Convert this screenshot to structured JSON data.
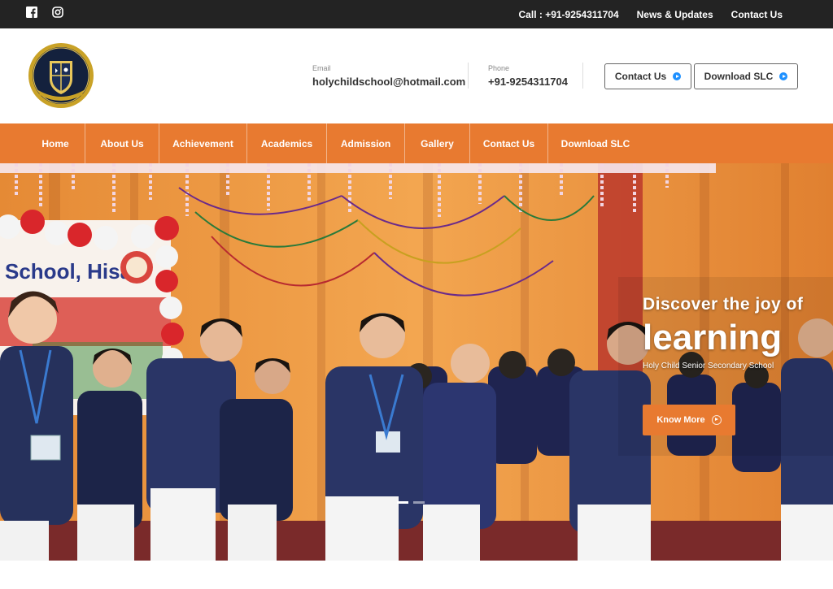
{
  "topbar": {
    "call": "Call : +91-9254311704",
    "news": "News & Updates",
    "contact": "Contact Us"
  },
  "header": {
    "email_label": "Email",
    "email": "holychildschool@hotmail.com",
    "phone_label": "Phone",
    "phone": "+91-9254311704",
    "contact_button": "Contact Us",
    "download_button": "Download SLC"
  },
  "nav": {
    "items": [
      {
        "label": "Home"
      },
      {
        "label": "About Us"
      },
      {
        "label": "Achievement"
      },
      {
        "label": "Academics"
      },
      {
        "label": "Admission"
      },
      {
        "label": "Gallery"
      },
      {
        "label": "Contact Us"
      },
      {
        "label": "Download SLC"
      }
    ]
  },
  "hero": {
    "subtitle": "Discover the joy of",
    "title": "learning",
    "school": "Holy Child Senior Secondary School",
    "button": "Know More",
    "banner_text": "School, Hisar"
  },
  "colors": {
    "accent": "#e87a30",
    "topbar": "#232323",
    "link_blue": "#1e90ff"
  },
  "icons": {
    "facebook": "facebook-icon",
    "instagram": "instagram-icon",
    "play": "play-circle-icon"
  }
}
